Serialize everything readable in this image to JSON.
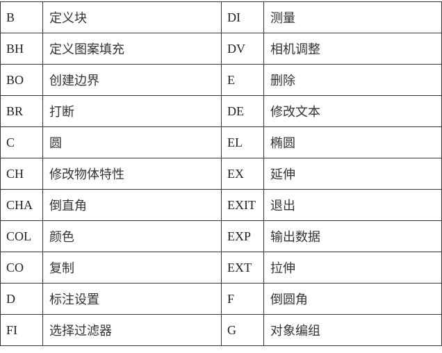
{
  "rows": [
    {
      "cmd1": "B",
      "desc1": "定义块",
      "cmd2": "DI",
      "desc2": "测量"
    },
    {
      "cmd1": "BH",
      "desc1": "定义图案填充",
      "cmd2": "DV",
      "desc2": "相机调整"
    },
    {
      "cmd1": "BO",
      "desc1": "创建边界",
      "cmd2": "E",
      "desc2": "删除"
    },
    {
      "cmd1": "BR",
      "desc1": "打断",
      "cmd2": "DE",
      "desc2": "修改文本"
    },
    {
      "cmd1": "C",
      "desc1": "圆",
      "cmd2": "EL",
      "desc2": "椭圆"
    },
    {
      "cmd1": "CH",
      "desc1": "修改物体特性",
      "cmd2": "EX",
      "desc2": "延伸"
    },
    {
      "cmd1": "CHA",
      "desc1": "倒直角",
      "cmd2": "EXIT",
      "desc2": "退出"
    },
    {
      "cmd1": "COL",
      "desc1": "颜色",
      "cmd2": "EXP",
      "desc2": "输出数据"
    },
    {
      "cmd1": "CO",
      "desc1": "复制",
      "cmd2": "EXT",
      "desc2": "拉伸"
    },
    {
      "cmd1": "D",
      "desc1": "标注设置",
      "cmd2": "F",
      "desc2": "倒圆角"
    },
    {
      "cmd1": "FI",
      "desc1": "选择过滤器",
      "cmd2": "G",
      "desc2": "对象编组"
    }
  ]
}
